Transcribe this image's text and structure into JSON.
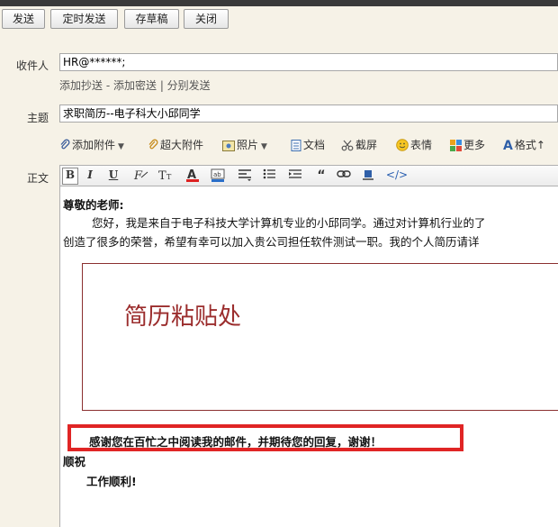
{
  "toolbar": {
    "send": "发送",
    "scheduled_send": "定时发送",
    "save_draft": "存草稿",
    "close": "关闭"
  },
  "form": {
    "to_label": "收件人",
    "to_value": "HR@******;",
    "add_cc": "添加抄送",
    "sep1": " - ",
    "add_bcc": "添加密送",
    "sep2": " | ",
    "split_send": "分别发送",
    "subject_label": "主题",
    "subject_value": "求职简历--电子科大小邱同学",
    "body_label": "正文"
  },
  "attach_bar": {
    "add_attachment": "添加附件",
    "large_attachment": "超大附件",
    "photo": "照片",
    "document": "文档",
    "screenshot": "截屏",
    "emoji": "表情",
    "more": "更多",
    "format": "格式"
  },
  "format_bar": {
    "bold": "B",
    "italic": "I",
    "underline": "U",
    "code": "</>"
  },
  "body": {
    "greeting": "尊敬的老师:",
    "para_line1": "您好，我是来自于电子科技大学计算机专业的小邱同学。通过对计算机行业的了",
    "para_line2": "创造了很多的荣誉，希望有幸可以加入贵公司担任软件测试一职。我的个人简历请详",
    "paste_placeholder": "简历粘贴处",
    "thanks": "感谢您在百忙之中阅读我的邮件，并期待您的回复，谢谢！",
    "closing": "顺祝",
    "wish": "工作顺利!"
  },
  "colors": {
    "page_bg": "#f6f2e7",
    "paste_border": "#8b3030",
    "paste_text": "#9b2d2d",
    "highlight_border": "#e02525"
  }
}
